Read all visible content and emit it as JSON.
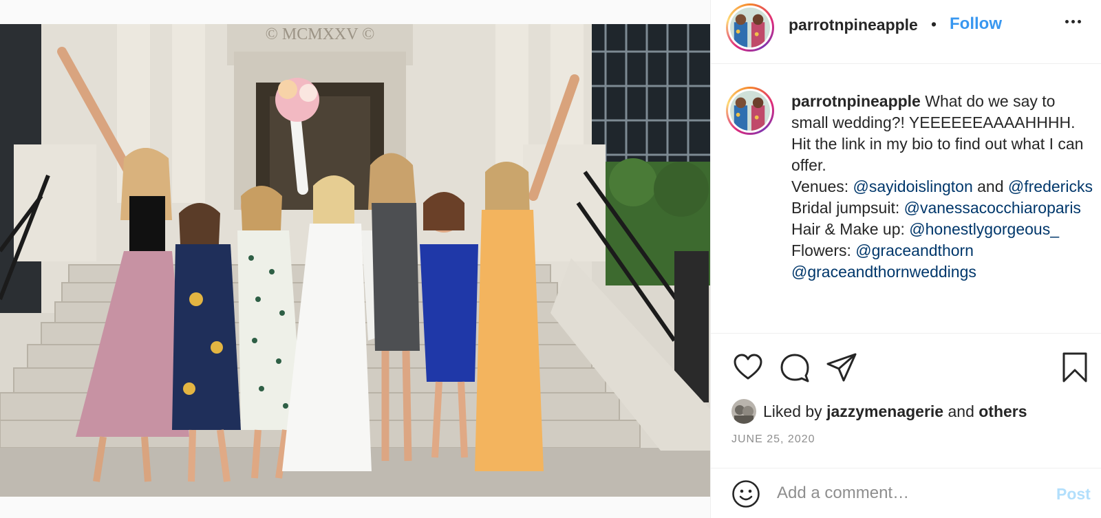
{
  "post": {
    "username": "parrotnpineapple",
    "separator": "•",
    "follow_label": "Follow",
    "more_label": "More options",
    "photo_inscription": "© MCMXXV ©",
    "caption": {
      "username": "parrotnpineapple",
      "text_1": " What do we say to small wedding?! YEEEEEEAAAAHHHH. Hit the link in my bio to find out what I can offer.",
      "venues_label": "Venues: ",
      "venue_mention_1": "@sayidoislington",
      "and_word": " and ",
      "venue_mention_2": "@fredericks",
      "jumpsuit_label": "Bridal jumpsuit: ",
      "jumpsuit_mention": "@vanessacocchiaroparis",
      "hair_label": "Hair & Make up: ",
      "hair_mention": "@honestlygorgeous_",
      "flowers_label": "Flowers: ",
      "flowers_mention_1": "@graceandthorn",
      "flowers_mention_2": "@graceandthornweddings"
    },
    "actions": {
      "like_icon": "heart-icon",
      "comment_icon": "comment-icon",
      "share_icon": "paper-plane-icon",
      "save_icon": "bookmark-icon"
    },
    "likes": {
      "prefix": "Liked by ",
      "user": "jazzymenagerie",
      "middle": " and ",
      "others": "others"
    },
    "date": "JUNE 25, 2020",
    "comment": {
      "emoji_icon": "smiley-icon",
      "placeholder": "Add a comment…",
      "post_label": "Post"
    }
  },
  "colors": {
    "accent": "#3897f0",
    "mention": "#00376b",
    "post_disabled": "#b2dffc",
    "muted": "#8e8e8e",
    "text": "#262626"
  }
}
